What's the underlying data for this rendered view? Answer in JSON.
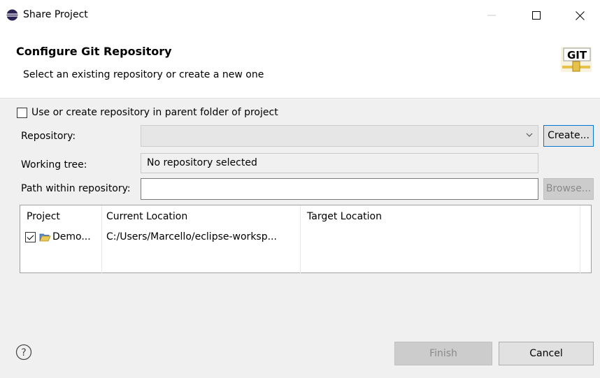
{
  "window": {
    "title": "Share Project",
    "icon": "eclipse-icon",
    "controls": [
      "minimize-icon",
      "maximize-icon",
      "close-icon"
    ]
  },
  "header": {
    "title": "Configure Git Repository",
    "description": "Select an existing repository or create a new one",
    "logo_text": "GIT"
  },
  "form": {
    "use_parent_label": "Use or create repository in parent folder of project",
    "use_parent_checked": false,
    "repository_label": "Repository:",
    "repository_value": "",
    "create_label": "Create...",
    "working_tree_label": "Working tree:",
    "working_tree_value": "No repository selected",
    "path_label": "Path within repository:",
    "path_value": "",
    "browse_label": "Browse..."
  },
  "table": {
    "columns": [
      "Project",
      "Current Location",
      "Target Location"
    ],
    "rows": [
      {
        "checked": true,
        "project": "Demo...",
        "current": "C:/Users/Marcello/eclipse-worksp...",
        "target": ""
      }
    ]
  },
  "footer": {
    "finish_label": "Finish",
    "cancel_label": "Cancel"
  },
  "colors": {
    "accent": "#0078d7",
    "body_bg": "#f0f0f0",
    "disabled_text": "#8a8a8a"
  }
}
